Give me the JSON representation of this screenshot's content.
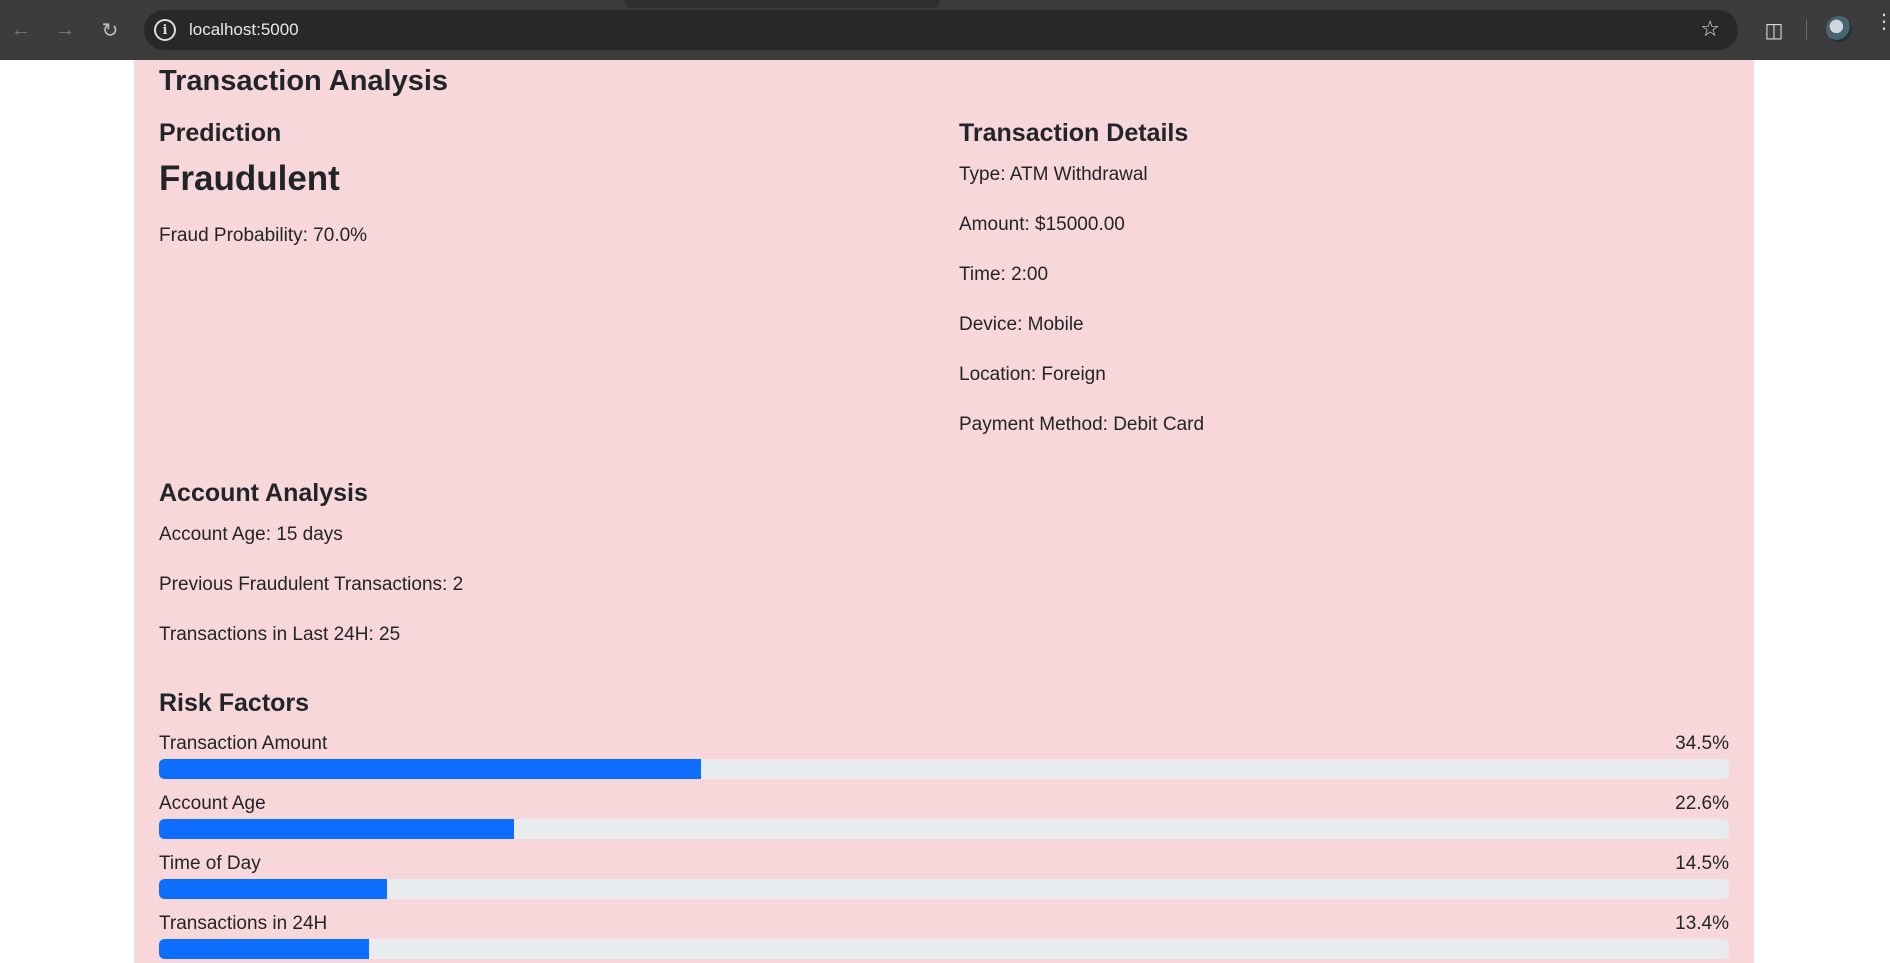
{
  "browser": {
    "url": "localhost:5000"
  },
  "page": {
    "title": "Transaction Analysis",
    "prediction": {
      "heading": "Prediction",
      "result": "Fraudulent",
      "probability_text": "Fraud Probability: 70.0%"
    },
    "transaction_details": {
      "heading": "Transaction Details",
      "items": [
        "Type: ATM Withdrawal",
        "Amount: $15000.00",
        "Time: 2:00",
        "Device: Mobile",
        "Location: Foreign",
        "Payment Method: Debit Card"
      ]
    },
    "account_analysis": {
      "heading": "Account Analysis",
      "items": [
        "Account Age: 15 days",
        "Previous Fraudulent Transactions: 2",
        "Transactions in Last 24H: 25"
      ]
    },
    "risk_factors": {
      "heading": "Risk Factors",
      "items": [
        {
          "label": "Transaction Amount",
          "percent_text": "34.5%",
          "value": 34.5
        },
        {
          "label": "Account Age",
          "percent_text": "22.6%",
          "value": 22.6
        },
        {
          "label": "Time of Day",
          "percent_text": "14.5%",
          "value": 14.5
        },
        {
          "label": "Transactions in 24H",
          "percent_text": "13.4%",
          "value": 13.4
        }
      ]
    }
  },
  "colors": {
    "alert_background": "#f8d7da",
    "progress_fill": "#0d6efd",
    "progress_track": "#e9ecef"
  },
  "icons": [
    "back-arrow-icon",
    "forward-arrow-icon",
    "reload-icon",
    "site-info-icon",
    "bookmark-star-icon",
    "extensions-icon",
    "profile-avatar",
    "menu-dots-icon"
  ]
}
